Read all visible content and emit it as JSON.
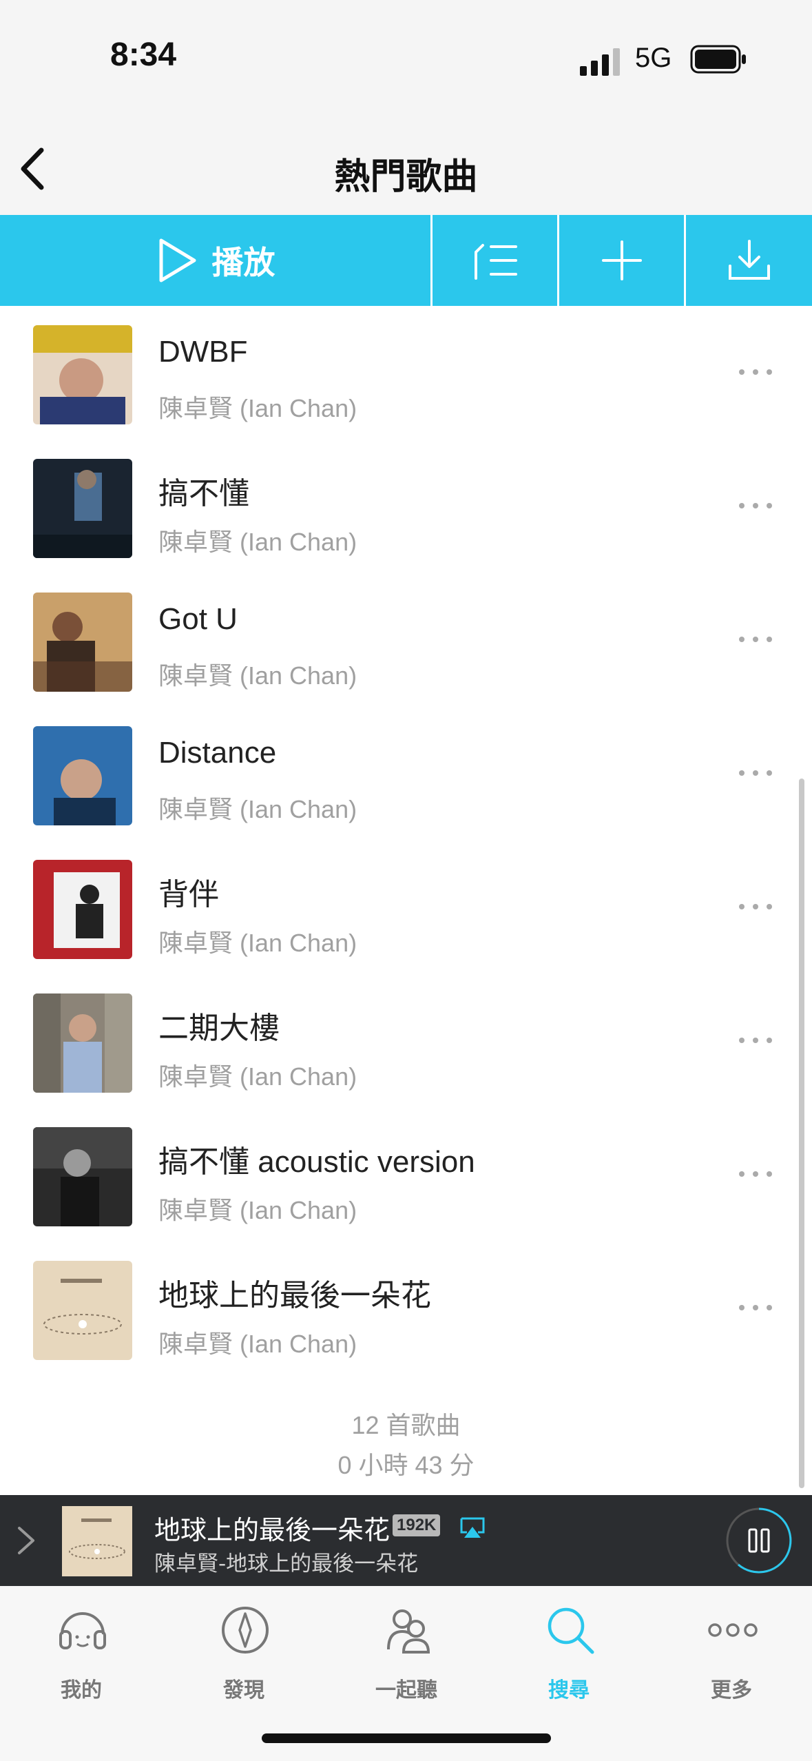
{
  "status": {
    "time": "8:34",
    "network": "5G"
  },
  "nav": {
    "title": "熱門歌曲"
  },
  "actions": {
    "play_label": "播放"
  },
  "songs": [
    {
      "title": "DWBF",
      "artist": "陳卓賢 (Ian Chan)"
    },
    {
      "title": "搞不懂",
      "artist": "陳卓賢 (Ian Chan)"
    },
    {
      "title": "Got U",
      "artist": "陳卓賢 (Ian Chan)"
    },
    {
      "title": "Distance",
      "artist": "陳卓賢 (Ian Chan)"
    },
    {
      "title": "背伴",
      "artist": "陳卓賢 (Ian Chan)"
    },
    {
      "title": "二期大樓",
      "artist": "陳卓賢 (Ian Chan)"
    },
    {
      "title": "搞不懂 acoustic version",
      "artist": "陳卓賢 (Ian Chan)"
    },
    {
      "title": "地球上的最後一朵花",
      "artist": "陳卓賢 (Ian Chan)"
    }
  ],
  "summary": {
    "count": "12 首歌曲",
    "duration": "0 小時 43 分"
  },
  "player": {
    "title": "地球上的最後一朵花",
    "quality": "192K",
    "subtitle": "陳卓賢-地球上的最後一朵花"
  },
  "tabs": [
    {
      "label": "我的",
      "icon": "headphones-icon",
      "active": false
    },
    {
      "label": "發現",
      "icon": "compass-icon",
      "active": false
    },
    {
      "label": "一起聽",
      "icon": "people-icon",
      "active": false
    },
    {
      "label": "搜尋",
      "icon": "search-icon",
      "active": true
    },
    {
      "label": "更多",
      "icon": "more-icon",
      "active": false
    }
  ],
  "colors": {
    "accent": "#2bc7ec",
    "player_bg": "#2b2d30",
    "muted_text": "#a0a0a0"
  }
}
